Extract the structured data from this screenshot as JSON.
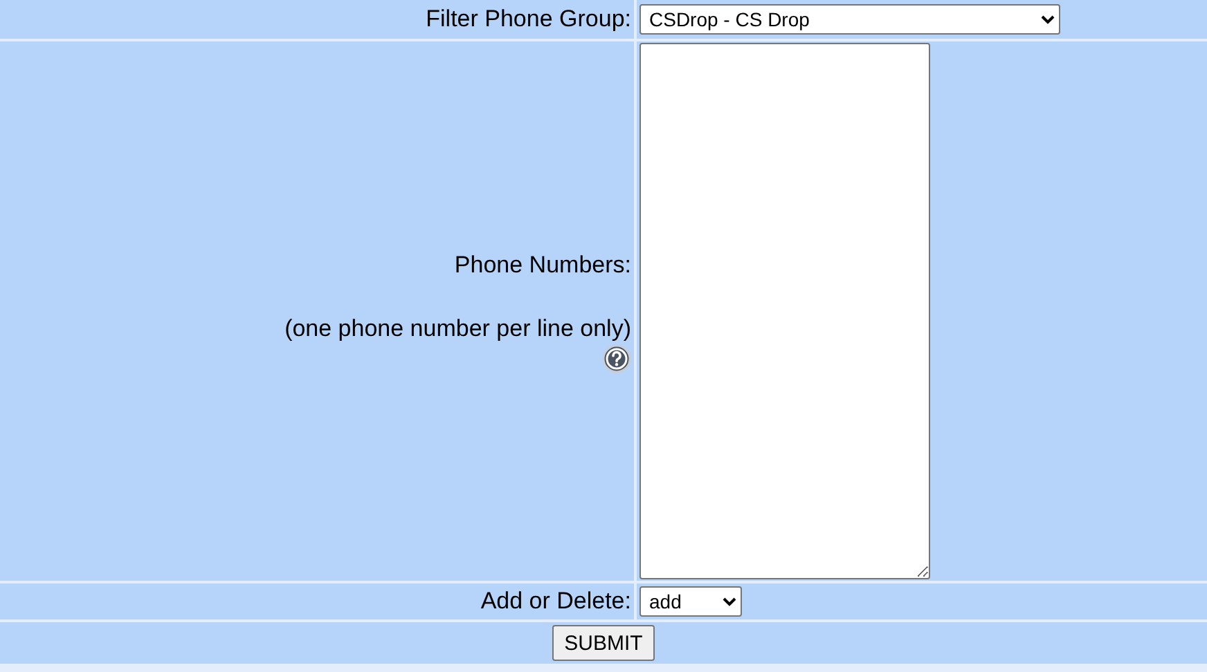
{
  "filter_phone_group": {
    "label": "Filter Phone Group:",
    "value": "CSDrop - CS Drop"
  },
  "phone_numbers": {
    "label": "Phone Numbers:",
    "hint": "(one phone number per line only)"
  },
  "add_or_delete": {
    "label": "Add or Delete:",
    "value": "add"
  },
  "submit": {
    "label": "SUBMIT"
  }
}
